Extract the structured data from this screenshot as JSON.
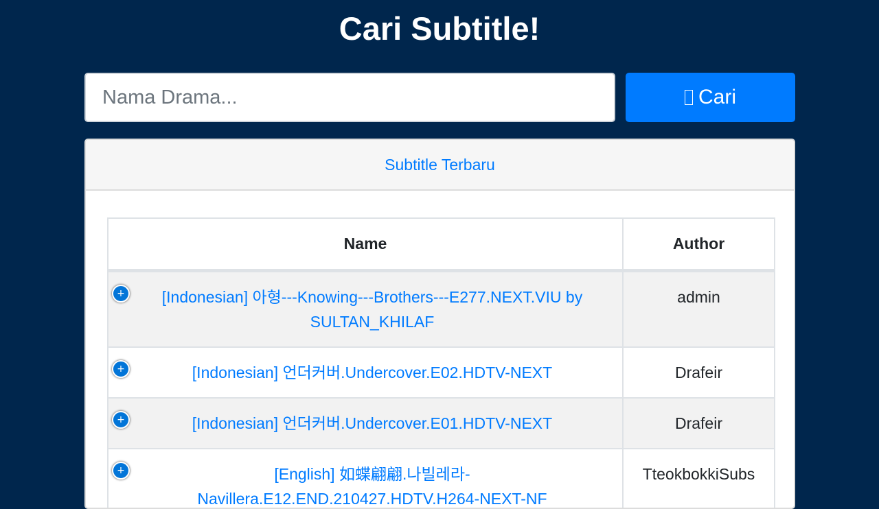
{
  "page": {
    "title": "Cari Subtitle!"
  },
  "search": {
    "placeholder": "Nama Drama...",
    "button_label": "Cari",
    "button_icon": "search-icon"
  },
  "card": {
    "header_link": "Subtitle Terbaru"
  },
  "table": {
    "columns": [
      "Name",
      "Author"
    ],
    "expand_glyph": "+",
    "rows": [
      {
        "name": "[Indonesian] 아형---Knowing---Brothers---E277.NEXT.VIU by SULTAN_KHILAF",
        "author": "admin"
      },
      {
        "name": "[Indonesian] 언더커버.Undercover.E02.HDTV-NEXT",
        "author": "Drafeir"
      },
      {
        "name": "[Indonesian] 언더커버.Undercover.E01.HDTV-NEXT",
        "author": "Drafeir"
      },
      {
        "name": "[English] 如蝶翩翩.나빌레라-Navillera.E12.END.210427.HDTV.H264-NEXT-NF",
        "author": "TteokbokkiSubs"
      }
    ]
  },
  "colors": {
    "background": "#00264d",
    "primary": "#007bff",
    "expand_button": "#0275d8"
  }
}
